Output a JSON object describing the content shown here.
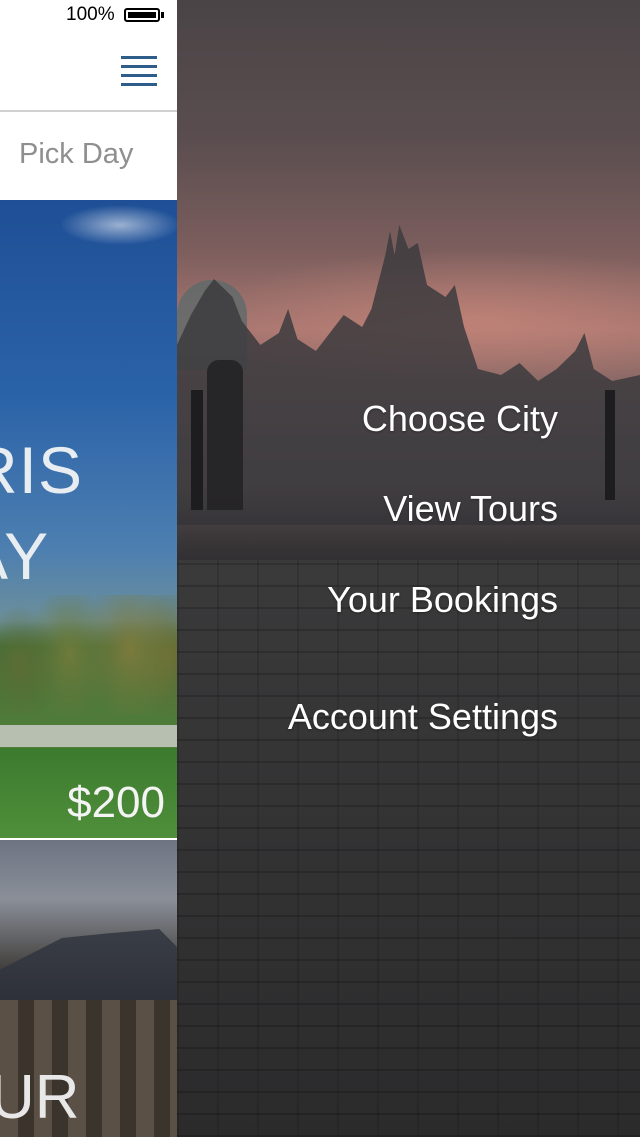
{
  "status_bar": {
    "battery_percent": "100%",
    "battery_level": 1.0
  },
  "app": {
    "filter": {
      "pick_day_label": "Pick Day"
    },
    "tours": [
      {
        "title_line1": "RIS",
        "title_line2": "AY",
        "price": "$200"
      },
      {
        "title_line1": "UR"
      }
    ]
  },
  "drawer": {
    "menu_items": [
      {
        "label": "Choose City"
      },
      {
        "label": "View Tours"
      },
      {
        "label": "Your Bookings"
      },
      {
        "label": "Account Settings"
      }
    ]
  },
  "colors": {
    "menu_icon": "#2f5d8a",
    "menu_text": "#ffffff",
    "pick_day_text": "#8f8f8f"
  }
}
